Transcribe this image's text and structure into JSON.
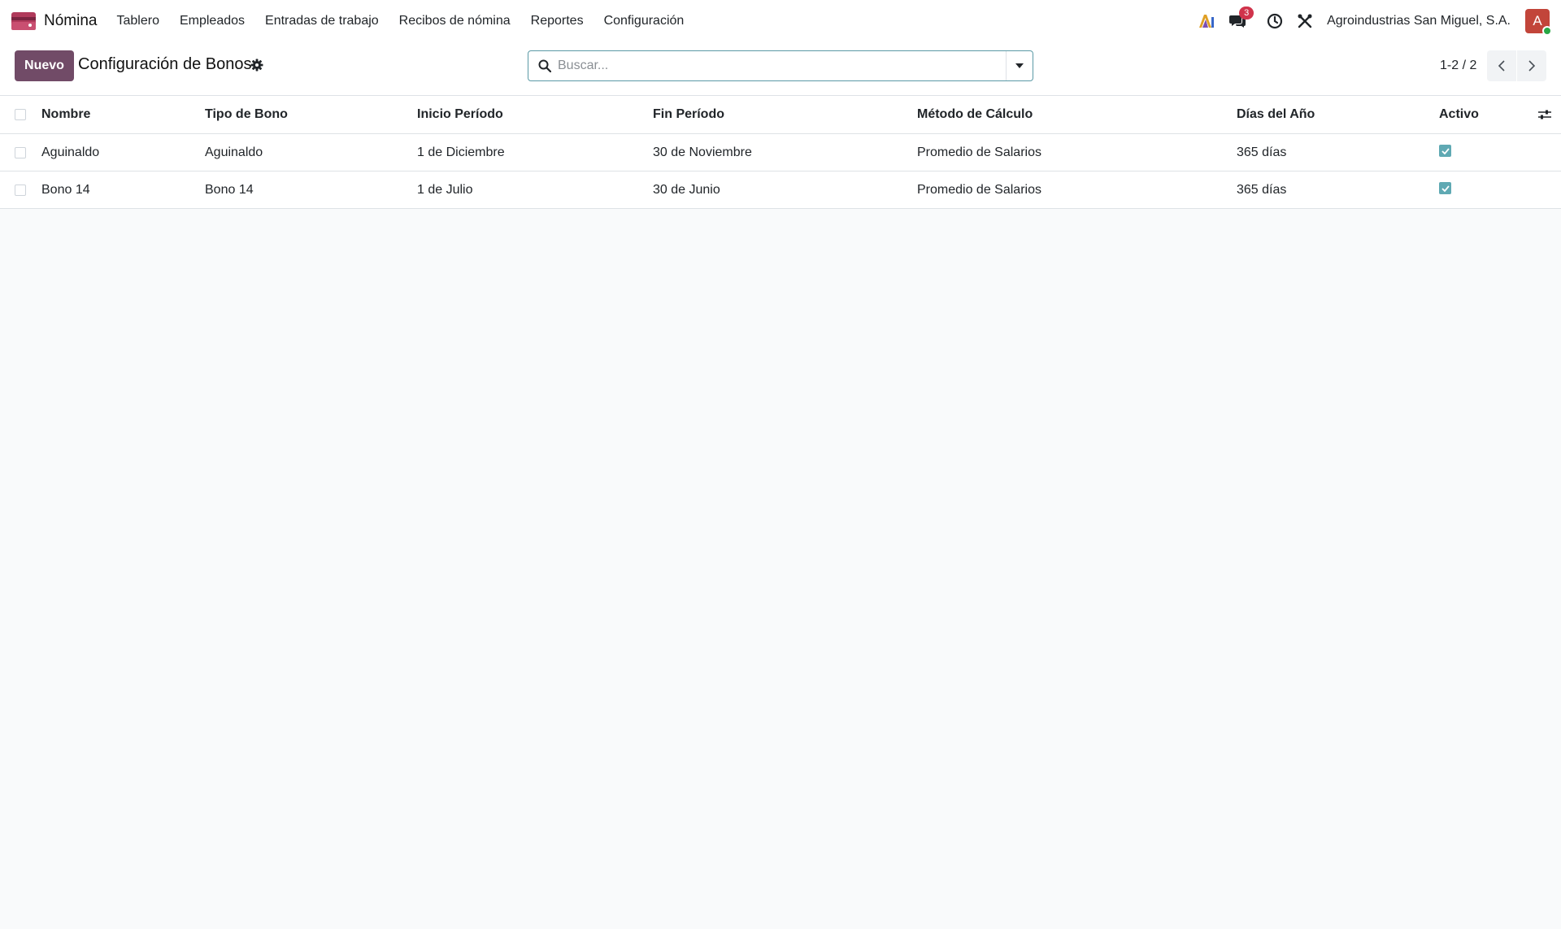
{
  "navbar": {
    "app_name": "Nómina",
    "menu": [
      "Tablero",
      "Empleados",
      "Entradas de trabajo",
      "Recibos de nómina",
      "Reportes",
      "Configuración"
    ],
    "messages_badge": "3",
    "company": "Agroindustrias San Miguel, S.A.",
    "avatar_initial": "A"
  },
  "control": {
    "new_button": "Nuevo",
    "title": "Configuración de Bonos",
    "search_placeholder": "Buscar...",
    "pager": "1-2 / 2"
  },
  "table": {
    "columns": [
      "Nombre",
      "Tipo de Bono",
      "Inicio Período",
      "Fin Período",
      "Método de Cálculo",
      "Días del Año",
      "Activo"
    ],
    "rows": [
      {
        "nombre": "Aguinaldo",
        "tipo": "Aguinaldo",
        "inicio": "1 de Diciembre",
        "fin": "30 de Noviembre",
        "metodo": "Promedio de Salarios",
        "dias": "365 días",
        "activo": true
      },
      {
        "nombre": "Bono 14",
        "tipo": "Bono 14",
        "inicio": "1 de Julio",
        "fin": "30 de Junio",
        "metodo": "Promedio de Salarios",
        "dias": "365 días",
        "activo": true
      }
    ]
  },
  "colors": {
    "primary": "#714b67",
    "accent": "#5fa9b3",
    "badge": "#d0334b",
    "avatar": "#c2453a"
  },
  "icons": [
    "payroll-app-icon",
    "ai-icon",
    "chat-icon",
    "clock-icon",
    "tools-icon",
    "gear-icon",
    "search-icon",
    "caret-down-icon",
    "chevron-left-icon",
    "chevron-right-icon",
    "optional-columns-icon",
    "checkmark-icon"
  ]
}
